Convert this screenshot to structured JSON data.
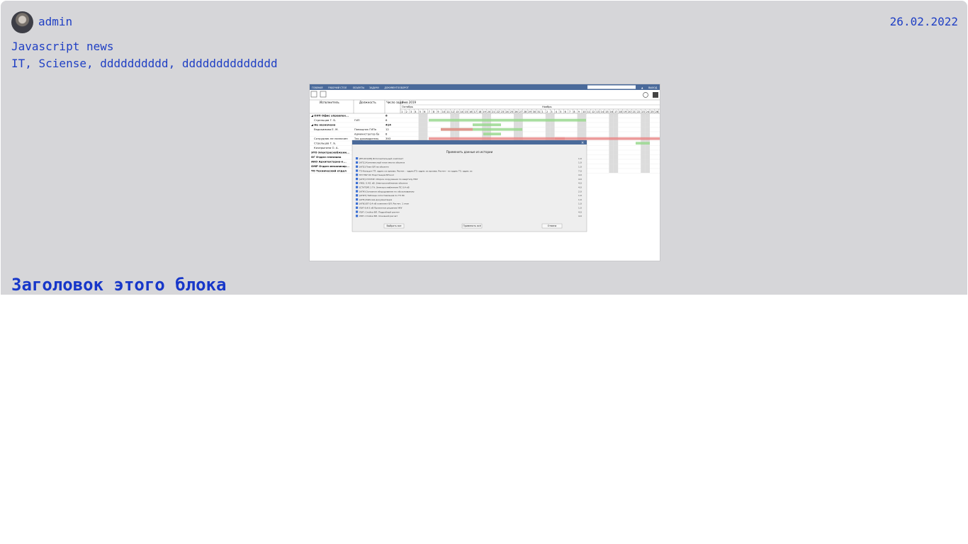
{
  "post": {
    "author": "admin",
    "date": "26.02.2022",
    "title": "Javascript news",
    "tags": [
      "IT",
      "Sciense",
      "dddddddddd",
      "dddddddddddddd"
    ],
    "block_heading": "Заголовок этого блока"
  },
  "screenshot": {
    "alt": "Screenshot",
    "topbar_menu": [
      "ГЛАВНАЯ",
      "РАБОЧИЙ СТОЛ",
      "ОБЪЕКТЫ",
      "ЗАДАЧИ",
      "ДОКУМЕНТООБОРОТ"
    ],
    "topbar_right": [
      "▲",
      "ВЫХОД"
    ],
    "columns": [
      "Исполнитель",
      "Должность",
      "Число задач"
    ],
    "timeline_header": [
      "4 кв 2019",
      "Октябрь",
      "Ноябрь"
    ],
    "rows": [
      {
        "name": "◢ ОУП Офис управлен...",
        "role": "",
        "count": "6",
        "bold": true
      },
      {
        "name": "Стрельцов Г. Б.",
        "role": "ГИП",
        "count": "6",
        "bold": false
      },
      {
        "name": "◢ Не назначено",
        "role": "",
        "count": "414",
        "bold": true
      },
      {
        "name": "Евдокимова Е. М.",
        "role": "Помощник ГИПа",
        "count": "12",
        "bold": false
      },
      {
        "name": "",
        "role": "Администратор ба",
        "count": "8",
        "bold": false
      },
      {
        "name": "Сотрудник не назначен",
        "role": "Тех руководитель",
        "count": "393",
        "bold": false
      },
      {
        "name": "Стрельцов Г. Б.",
        "role": "",
        "count": "",
        "bold": false
      },
      {
        "name": "Кочерыгина О. А.",
        "role": "",
        "count": "",
        "bold": false
      },
      {
        "name": "ЭТО Электроснабжени...",
        "role": "",
        "count": "",
        "bold": true
      },
      {
        "name": "ОГ Отдел генплана",
        "role": "",
        "count": "",
        "bold": true
      },
      {
        "name": "АКО Архитектурно-к...",
        "role": "",
        "count": "",
        "bold": true
      },
      {
        "name": "ОМР Отдел механизир...",
        "role": "",
        "count": "",
        "bold": true
      },
      {
        "name": "ТО Технический отдел",
        "role": "",
        "count": "",
        "bold": true
      }
    ],
    "dialog": {
      "title": "Применить данные из истории",
      "items": [
        "[ЕП-001/08] Исполнительный комплект",
        "[АП1] Комплексный план места объекта",
        "[АП2] План ВЛ на объекте",
        "ТЗ-Кальцит ГП: адрес из архива. Расчет. - адрес/ТЗ: адрес из архива. Расчет - по адрес ТЗ. адрес из архива. Расчет. - по адрес ТЗ адрес архива. Расчет - по адрес",
        "ПЛ НКУ ОС Подстанция ВЛ-кол",
        "[АП3] СТАТОР. Сборка сооружения по кварталу НКУ",
        "УЖЭ. 0.4/1 кВ. Электроснабжение объекта",
        "[СТАТОР] 1 ГА. Электроснабжение ПС 0,4 кВ",
        "[АП4] Основное оборудование по обслуживанию",
        "[АП4Т] Таблица сопоставления по ТЗ ЭС",
        "[АП5] Рабочая документация",
        "[АП6] ЕП 0,4 кВ комплект ВЛ. Расчет. 1 этап",
        "ЛЭП-0,4/1 кВ Проектное решение НКУ",
        "ЛЭП. Стойки ВЛ. Подробный расчет",
        "ЛЭП. Стойки ВЛ. Основной расчет"
      ],
      "values": [
        "1.0",
        "1.0",
        "1.0",
        "7.0",
        "4.0",
        "4.0",
        "4.0",
        "4.0",
        "2.0",
        "1.0",
        "1.0",
        "1.0",
        "1.0",
        "4.0",
        "4.0"
      ],
      "buttons": [
        "Выбрать все",
        "Применить всё",
        "Отмена"
      ]
    },
    "colors": {
      "accent": "#1f3fc4",
      "card_bg": "#d6d6d9",
      "topbar": "#4a6a9a",
      "bar_red": "#e98b8b",
      "bar_green": "#9ad88f",
      "weekend": "#dcdcdc"
    }
  }
}
